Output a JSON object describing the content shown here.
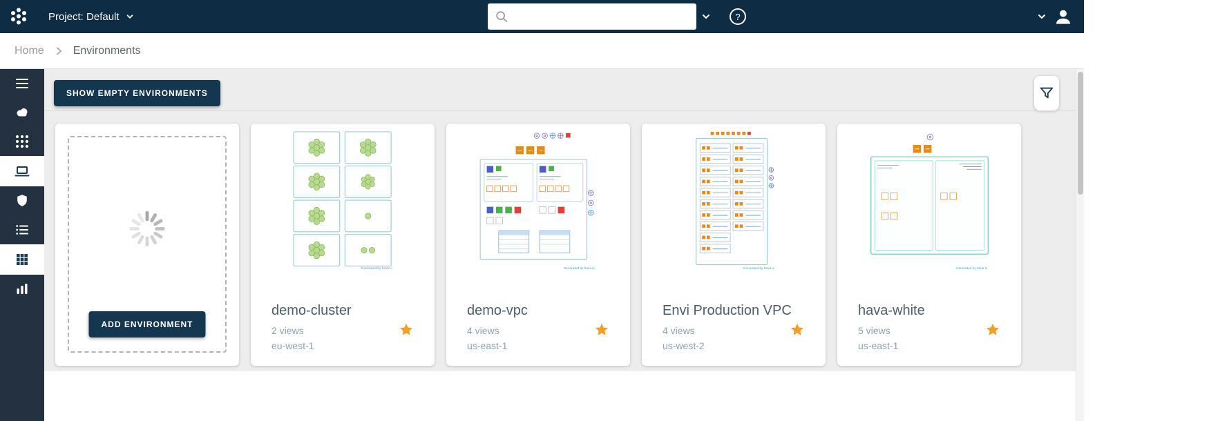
{
  "topbar": {
    "project_label": "Project: Default",
    "search_value": "",
    "search_placeholder": "",
    "help_glyph": "?"
  },
  "breadcrumb": {
    "home": "Home",
    "current": "Environments"
  },
  "toolbar": {
    "show_empty_label": "SHOW EMPTY ENVIRONMENTS"
  },
  "sidebar": {
    "items": [
      {
        "icon": "menu"
      },
      {
        "icon": "cloud-sync"
      },
      {
        "icon": "apps-grid"
      },
      {
        "icon": "environments-laptop",
        "active": true
      },
      {
        "icon": "security-shield"
      },
      {
        "icon": "list"
      },
      {
        "icon": "diagram-grid",
        "active": true
      },
      {
        "icon": "stats-chart"
      }
    ]
  },
  "add_card": {
    "button_label": "ADD ENVIRONMENT"
  },
  "environments": [
    {
      "title": "demo-cluster",
      "views": "2 views",
      "region": "eu-west-1",
      "favorited": true,
      "caption": "Generated by hava.io"
    },
    {
      "title": "demo-vpc",
      "views": "4 views",
      "region": "us-east-1",
      "favorited": true,
      "caption": "Generated by hava.io"
    },
    {
      "title": "Envi Production VPC",
      "views": "4 views",
      "region": "us-west-2",
      "favorited": true,
      "caption": "Generated by hava.io"
    },
    {
      "title": "hava-white",
      "views": "5 views",
      "region": "us-east-1",
      "favorited": true,
      "caption": "Generated by hava.io"
    }
  ],
  "colors": {
    "topbar_navy": "#0e2c44",
    "sidebar_dark": "#233140",
    "button_navy": "#15364f",
    "star_orange": "#f0a028",
    "diagram_orange": "#e8891c",
    "diagram_teal": "#8fc7d8"
  }
}
